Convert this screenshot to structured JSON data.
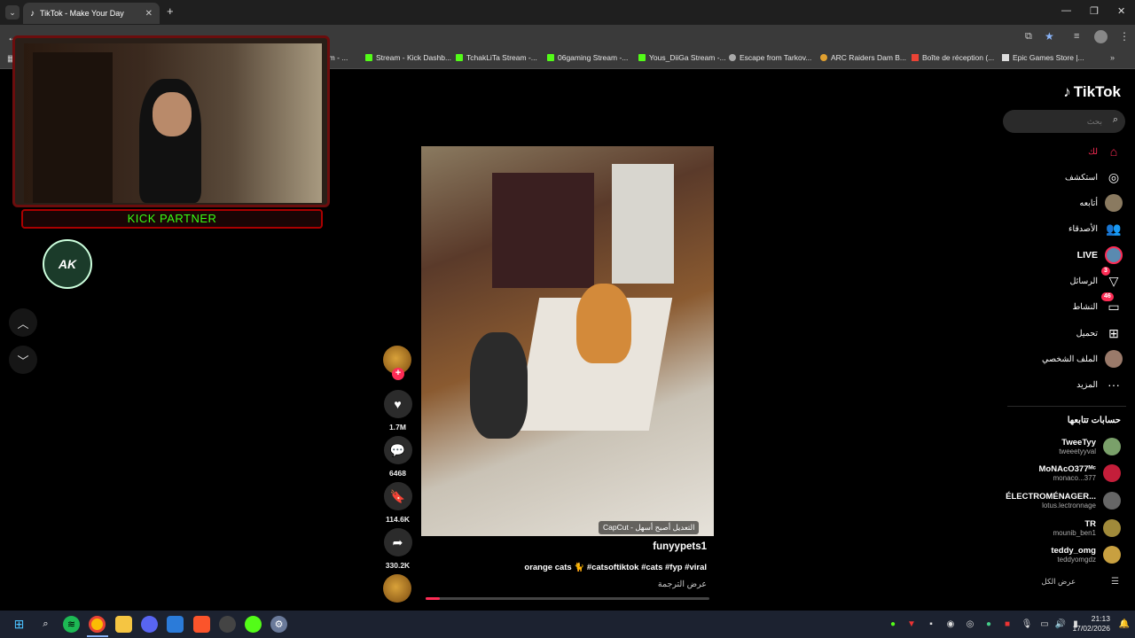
{
  "browser": {
    "tab_title": "TikTok - Make Your Day",
    "new_tab_icon": "plus-icon",
    "bookmarks": [
      {
        "label": "tream - ...",
        "icon": "kick"
      },
      {
        "label": "Stream - Kick Dashb...",
        "icon": "kick"
      },
      {
        "label": "TchakLiTa Stream -...",
        "icon": "kick"
      },
      {
        "label": "06gaming Stream -...",
        "icon": "kick"
      },
      {
        "label": "Yous_DiiGa Stream -...",
        "icon": "kick"
      },
      {
        "label": "Escape from Tarkov...",
        "icon": "tarkov"
      },
      {
        "label": "ARC Raiders Dam B...",
        "icon": "arc"
      },
      {
        "label": "Boîte de réception (...",
        "icon": "gmail"
      },
      {
        "label": "Epic Games Store |...",
        "icon": "epic"
      }
    ]
  },
  "overlay": {
    "kick_badge": "KICK PARTNER",
    "logo_text": "AK"
  },
  "video": {
    "capcut_label": "CapCut - التعديل أصبح أسهل",
    "author": "funyypets1",
    "caption": "orange cats 🐈 #catsoftiktok #cats #fyp #viral",
    "translate": "عرض الترجمة",
    "progress": 0.05,
    "actions": {
      "likes": "1.7M",
      "comments": "6468",
      "saves": "114.6K",
      "shares": "330.2K"
    }
  },
  "sidebar": {
    "logo": "TikTok",
    "search_placeholder": "بحث",
    "nav": [
      {
        "label": "لك",
        "icon": "home-icon",
        "active": true
      },
      {
        "label": "استكشف",
        "icon": "compass-icon"
      },
      {
        "label": "أتابعه",
        "icon": "avatar"
      },
      {
        "label": "الأصدقاء",
        "icon": "friends-icon"
      },
      {
        "label": "LIVE",
        "icon": "live-avatar"
      },
      {
        "label": "الرسائل",
        "icon": "send-icon",
        "badge": "3"
      },
      {
        "label": "النشاط",
        "icon": "inbox-icon",
        "badge": "46"
      },
      {
        "label": "تحميل",
        "icon": "upload-icon"
      },
      {
        "label": "الملف الشخصي",
        "icon": "avatar"
      },
      {
        "label": "المزيد",
        "icon": "more-icon"
      }
    ],
    "following_title": "حسابات تتابعها",
    "accounts": [
      {
        "name": "TweeTyy",
        "user": "tweeetyyval",
        "color": "#7aa06a"
      },
      {
        "name": "MoNAcO377ᴹᶜ",
        "user": "monaco...377",
        "color": "#c41e3a"
      },
      {
        "name": "ÉLECTROMÉNAGER...",
        "user": "lotus.lectronnage",
        "color": "#666666"
      },
      {
        "name": "TR",
        "user": "mounib_ben1",
        "color": "#a08a3a"
      },
      {
        "name": "teddy_omg",
        "user": "teddyomgdz",
        "color": "#c8a040"
      }
    ],
    "see_all": "عرض الكل"
  },
  "taskbar": {
    "time": "21:13",
    "date": "17/02/2026"
  }
}
